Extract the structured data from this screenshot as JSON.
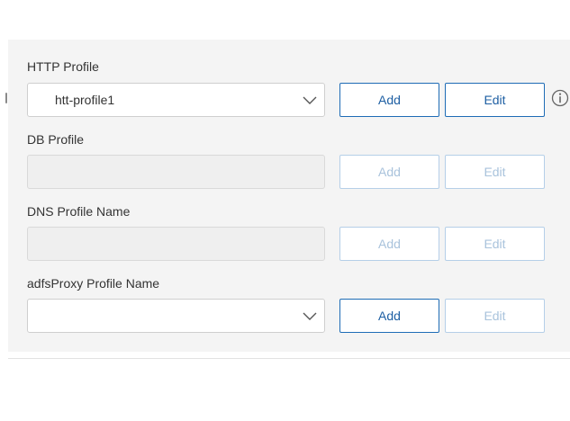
{
  "form": {
    "rows": [
      {
        "label": "HTTP Profile",
        "value": "htt-profile1",
        "add_label": "Add",
        "edit_label": "Edit"
      },
      {
        "label": "DB Profile",
        "value": "",
        "add_label": "Add",
        "edit_label": "Edit"
      },
      {
        "label": "DNS Profile Name",
        "value": "",
        "add_label": "Add",
        "edit_label": "Edit"
      },
      {
        "label": "adfsProxy Profile Name",
        "value": "",
        "add_label": "Add",
        "edit_label": "Edit"
      }
    ]
  },
  "icons": {
    "chevron": "chevron-down-icon",
    "info": "info-icon"
  },
  "colors": {
    "accent": "#1e6cb6",
    "disabled_accent": "#b5cfe8",
    "panel_bg": "#f4f4f4",
    "disabled_field_bg": "#efefef"
  }
}
